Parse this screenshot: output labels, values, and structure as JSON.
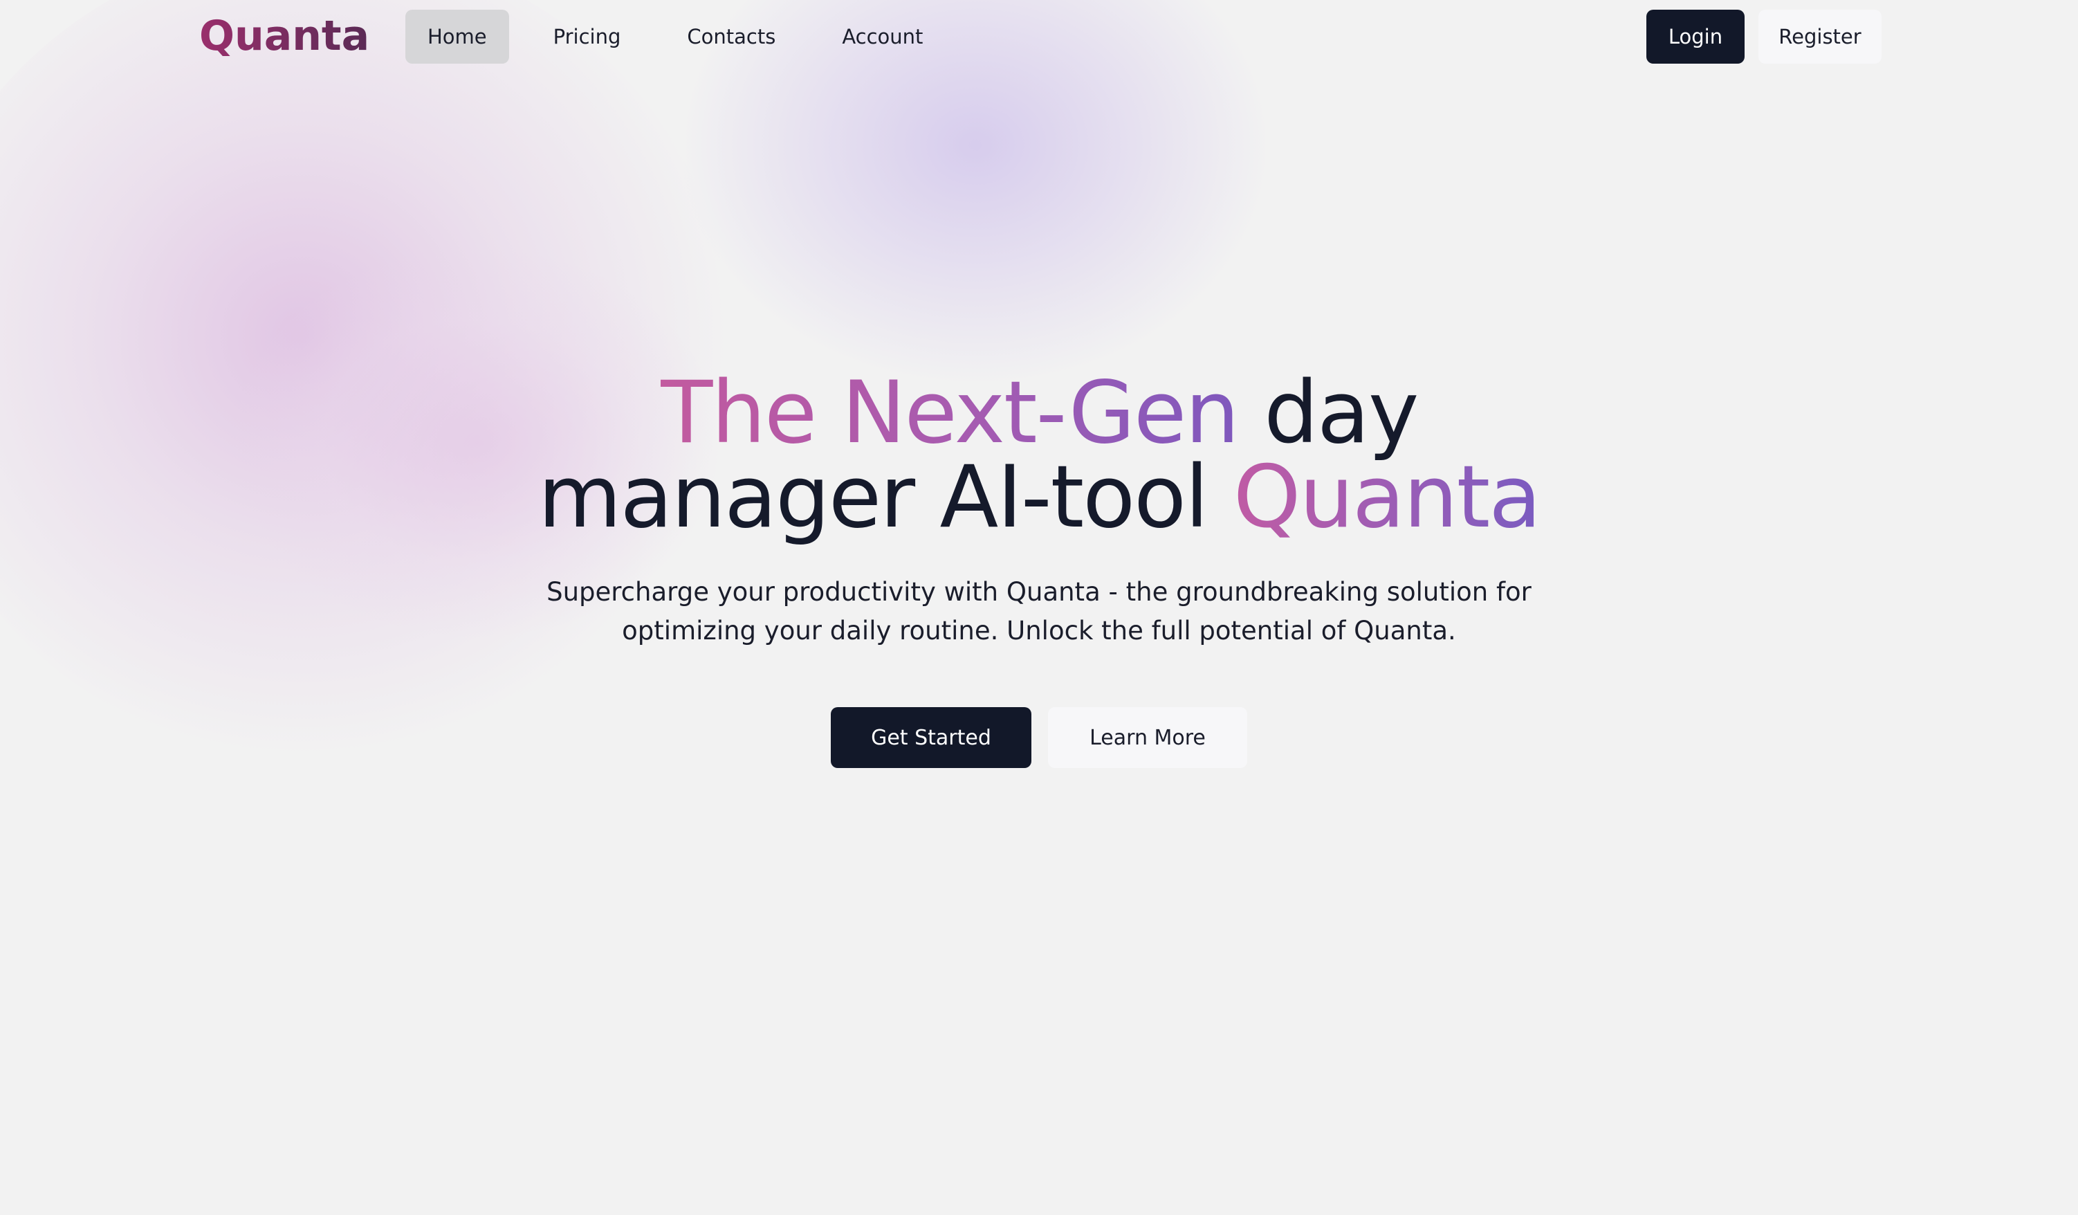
{
  "brand": {
    "name": "Quanta"
  },
  "nav": {
    "links": [
      {
        "label": "Home",
        "active": true
      },
      {
        "label": "Pricing",
        "active": false
      },
      {
        "label": "Contacts",
        "active": false
      },
      {
        "label": "Account",
        "active": false
      }
    ]
  },
  "auth": {
    "login_label": "Login",
    "register_label": "Register"
  },
  "hero": {
    "title_line1_gradient": "The Next-Gen",
    "title_line1_plain": " day",
    "title_line2_plain": "manager AI-tool ",
    "title_line2_gradient": "Quanta",
    "subtitle": "Supercharge your productivity with Quanta - the groundbreaking solution for optimizing your daily routine. Unlock the full potential of Quanta.",
    "primary_cta": "Get Started",
    "secondary_cta": "Learn More"
  },
  "colors": {
    "background": "#f2f2f2",
    "brand": "#8a2c63",
    "dark_button": "#121829",
    "gradient_start": "#c25a9f",
    "gradient_end": "#7f58bd",
    "active_nav": "#d6d6d8"
  }
}
